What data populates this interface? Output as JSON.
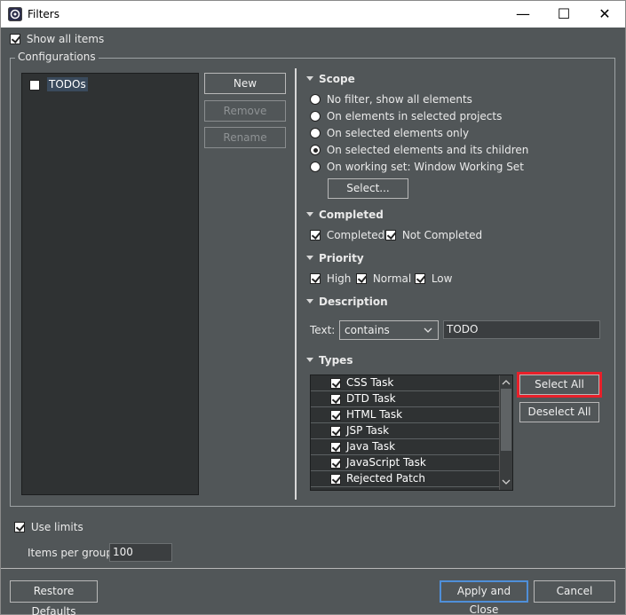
{
  "window": {
    "title": "Filters",
    "minimize": "—",
    "maximize": "☐",
    "close": "✕"
  },
  "show_all_items": {
    "label": "Show all items",
    "checked": true
  },
  "configurations": {
    "legend": "Configurations",
    "items": [
      {
        "label": "TODOs",
        "checked": false
      }
    ],
    "buttons": {
      "new": "New",
      "remove": "Remove",
      "rename": "Rename"
    }
  },
  "scope": {
    "title": "Scope",
    "options": [
      {
        "label": "No filter, show all elements",
        "selected": false
      },
      {
        "label": "On elements in selected projects",
        "selected": false
      },
      {
        "label": "On selected elements only",
        "selected": false
      },
      {
        "label": "On selected elements and its children",
        "selected": true
      },
      {
        "label": "On working set:  Window Working Set",
        "selected": false
      }
    ],
    "select_button": "Select..."
  },
  "completed": {
    "title": "Completed",
    "completed": "Completed",
    "not_completed": "Not Completed"
  },
  "priority": {
    "title": "Priority",
    "high": "High",
    "normal": "Normal",
    "low": "Low"
  },
  "description": {
    "title": "Description",
    "text_label": "Text:",
    "operator": "contains",
    "value": "TODO"
  },
  "types": {
    "title": "Types",
    "items": [
      "CSS Task",
      "DTD Task",
      "HTML Task",
      "JSP Task",
      "Java Task",
      "JavaScript Task",
      "Rejected Patch"
    ],
    "select_all": "Select All",
    "deselect_all": "Deselect All"
  },
  "limits": {
    "use_limits": "Use limits",
    "items_per_group_label": "Items per group:",
    "items_per_group": "100"
  },
  "footer": {
    "restore_defaults": "Restore Defaults",
    "apply_close": "Apply and Close",
    "cancel": "Cancel"
  },
  "colors": {
    "background": "#515658",
    "highlight": "#e8202a",
    "list_bg": "#2f3233"
  }
}
